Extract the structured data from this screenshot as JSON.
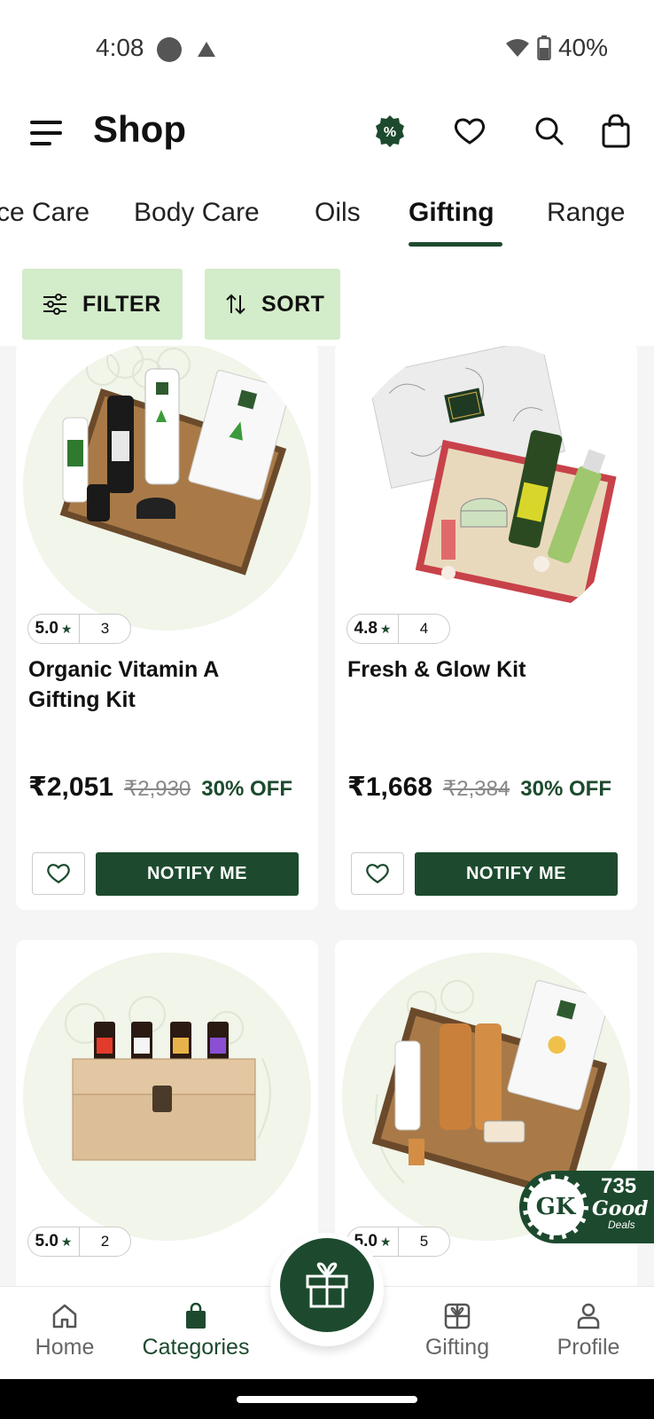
{
  "status_bar": {
    "time": "4:08",
    "battery": "40%"
  },
  "header": {
    "title": "Shop"
  },
  "tabs": [
    "ce Care",
    "Body Care",
    "Oils",
    "Gifting",
    "Range"
  ],
  "active_tab": "Gifting",
  "filters": {
    "filter_label": "FILTER",
    "sort_label": "SORT"
  },
  "products": [
    {
      "rating": "5.0",
      "reviews": "3",
      "name": "Organic Vitamin A Gifting Kit",
      "price": "₹2,051",
      "mrp": "₹2,930",
      "discount": "30% OFF",
      "button": "NOTIFY ME"
    },
    {
      "rating": "4.8",
      "reviews": "4",
      "name": "Fresh & Glow Kit",
      "price": "₹1,668",
      "mrp": "₹2,384",
      "discount": "30% OFF",
      "button": "NOTIFY ME"
    },
    {
      "rating": "5.0",
      "reviews": "2"
    },
    {
      "rating": "5.0",
      "reviews": "5"
    }
  ],
  "deals_badge": {
    "count": "735",
    "label": "Good",
    "sub": "Deals",
    "logo": "GK"
  },
  "bottom_nav": {
    "home": "Home",
    "categories": "Categories",
    "gifting": "Gifting",
    "profile": "Profile"
  },
  "colors": {
    "brand_green": "#1d4a2e",
    "chip_bg": "#d3ecc9"
  },
  "icons": [
    "menu-icon",
    "offer-percent-icon",
    "heart-icon",
    "search-icon",
    "bag-icon",
    "filter-icon",
    "sort-icon",
    "gift-icon",
    "home-icon",
    "profile-icon"
  ]
}
